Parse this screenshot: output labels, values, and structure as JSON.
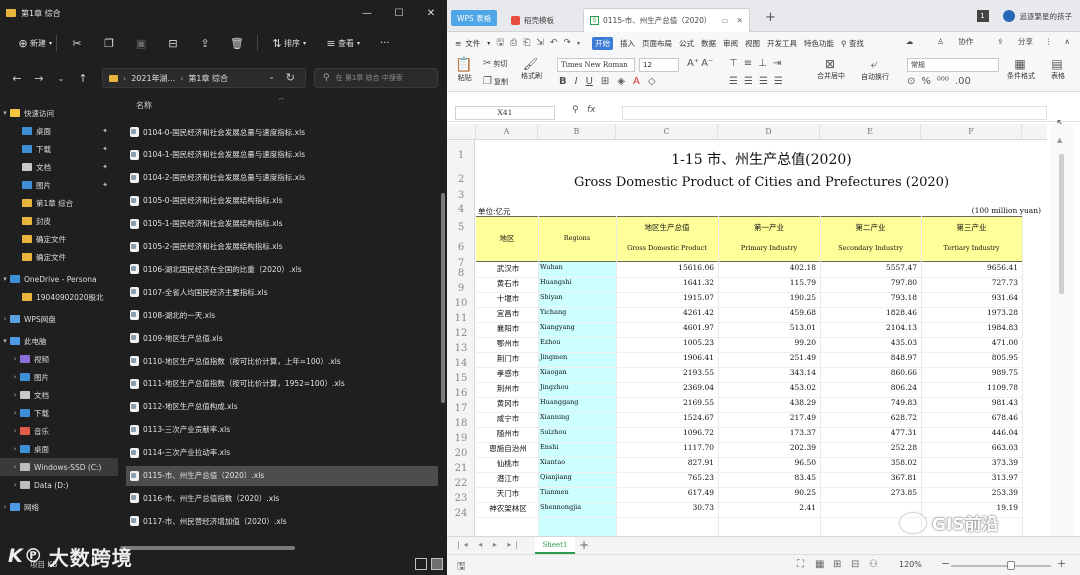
{
  "explorer": {
    "title": "第1章 综合",
    "controls": [
      "—",
      "☐",
      "✕"
    ],
    "commands": {
      "new": "新建",
      "sort": "排序",
      "view": "查看",
      "more": "···"
    },
    "address": {
      "segments": [
        "2021年湖...",
        "第1章 综合"
      ]
    },
    "search_placeholder": "在 第1章 综合 中搜索",
    "column_header": "名称",
    "nav": [
      {
        "label": "快速访问",
        "expander": "▾",
        "icon": "star-icon",
        "color": "#f4c542"
      },
      {
        "label": "桌面",
        "icon": "desktop-icon",
        "color": "#3f8fd8",
        "pinned": true
      },
      {
        "label": "下载",
        "icon": "download-icon",
        "color": "#3f8fd8",
        "pinned": true
      },
      {
        "label": "文档",
        "icon": "document-icon",
        "color": "#c9c9c9",
        "pinned": true
      },
      {
        "label": "图片",
        "icon": "picture-icon",
        "color": "#3f8fd8",
        "pinned": true
      },
      {
        "label": "第1章 综合",
        "icon": "folder-icon",
        "color": "#e8b53c"
      },
      {
        "label": "封皮",
        "icon": "folder-icon",
        "color": "#e8b53c"
      },
      {
        "label": "确定文件",
        "icon": "folder-icon",
        "color": "#e8b53c"
      },
      {
        "label": "确定文件",
        "icon": "folder-icon",
        "color": "#e8b53c"
      },
      {
        "label": "OneDrive - Persona",
        "expander": "▾",
        "icon": "cloud-icon",
        "color": "#3f8fd8"
      },
      {
        "label": "19040902020股北",
        "icon": "folder-icon",
        "color": "#e8b53c"
      },
      {
        "label": "WPS网盘",
        "expander": "›",
        "icon": "cloud-drive-icon",
        "color": "#5aa0e0"
      },
      {
        "label": "此电脑",
        "expander": "▾",
        "icon": "computer-icon",
        "color": "#4f9be6"
      },
      {
        "label": "视频",
        "expander": "›",
        "icon": "video-icon",
        "color": "#8a6fd6"
      },
      {
        "label": "图片",
        "expander": "›",
        "icon": "picture-icon",
        "color": "#3f8fd8"
      },
      {
        "label": "文档",
        "expander": "›",
        "icon": "document-icon",
        "color": "#c9c9c9"
      },
      {
        "label": "下载",
        "expander": "›",
        "icon": "download-icon",
        "color": "#3f8fd8"
      },
      {
        "label": "音乐",
        "expander": "›",
        "icon": "music-icon",
        "color": "#e35c4a"
      },
      {
        "label": "桌面",
        "expander": "›",
        "icon": "desktop-icon",
        "color": "#3f8fd8"
      },
      {
        "label": "Windows-SSD (C:)",
        "expander": "›",
        "icon": "drive-icon",
        "color": "#bdbdbd",
        "selected": true
      },
      {
        "label": "Data (D:)",
        "expander": "›",
        "icon": "drive-icon",
        "color": "#bdbdbd"
      },
      {
        "label": "网络",
        "expander": "›",
        "icon": "network-icon",
        "color": "#4f9be6"
      }
    ],
    "files": [
      "0104-0-国民经济和社会发展总量与速度指标.xls",
      "0104-1-国民经济和社会发展总量与速度指标.xls",
      "0104-2-国民经济和社会发展总量与速度指标.xls",
      "0105-0-国民经济和社会发展结构指标.xls",
      "0105-1-国民经济和社会发展结构指标.xls",
      "0105-2-国民经济和社会发展结构指标.xls",
      "0106-湖北国民经济在全国的比重（2020）.xls",
      "0107-全省人均国民经济主要指标.xls",
      "0108-湖北的一天.xls",
      "0109-地区生产总值.xls",
      "0110-地区生产总值指数（按可比价计算，上年=100）.xls",
      "0111-地区生产总值指数（按可比价计算，1952=100）.xls",
      "0112-地区生产总值构成.xls",
      "0113-三次产业贡献率.xls",
      "0114-三次产业拉动率.xls",
      "0115-市、州生产总值（2020）.xls",
      "0116-市、州生产总值指数（2020）.xls",
      "0117-市、州民营经济增加值（2020）.xls"
    ],
    "selected_file_index": 15,
    "status": "项目  KB",
    "watermark": "大数跨境"
  },
  "wps": {
    "tabs": {
      "home": "WPS 表格",
      "template": "稻壳模板",
      "active": "0115-市、州生产总值（2020）"
    },
    "user_name": "追逐繁星的孩子",
    "menu": [
      "文件",
      "开始",
      "插入",
      "页面布局",
      "公式",
      "数据",
      "审阅",
      "视图",
      "开发工具",
      "特色功能",
      "查找"
    ],
    "menu_right": [
      "协作",
      "分享"
    ],
    "ribbon": {
      "paste": "粘贴",
      "cut": "剪切",
      "copy": "复制",
      "format_painter": "格式刷",
      "font_name": "Times New Roman",
      "font_size": "12",
      "merge": "合并居中",
      "wrap": "自动换行",
      "number_format": "常规",
      "cond_format": "条件格式",
      "table_style": "表格"
    },
    "name_box": "X41",
    "fx": "fx",
    "columns": [
      "A",
      "B",
      "C",
      "D",
      "E",
      "F"
    ],
    "rows": [
      "1",
      "2",
      "3",
      "4",
      "5",
      "6",
      "7",
      "8",
      "9",
      "10",
      "11",
      "12",
      "13",
      "14",
      "15",
      "16",
      "17",
      "18",
      "19",
      "20",
      "21",
      "22",
      "23",
      "24"
    ],
    "sheet": {
      "title_cn": "1-15  市、州生产总值(2020)",
      "title_en": "Gross Domestic Product of Cities and Prefectures (2020)",
      "unit_cn": "单位:亿元",
      "unit_en": "(100 million yuan)",
      "headers": {
        "region_cn": "地区",
        "region_en": "Regions",
        "gdp_cn": "地区生产总值",
        "gdp_en": "Gross Domestic Product",
        "primary_cn": "第一产业",
        "primary_en": "Primary Industry",
        "secondary_cn": "第二产业",
        "secondary_en": "Secondary Industry",
        "tertiary_cn": "第三产业",
        "tertiary_en": "Tertiary Industry"
      },
      "data": [
        [
          "武汉市",
          "Wuhan",
          "15616.06",
          "402.18",
          "5557.47",
          "9656.41"
        ],
        [
          "黄石市",
          "Huangshi",
          "1641.32",
          "115.79",
          "797.80",
          "727.73"
        ],
        [
          "十堰市",
          "Shiyan",
          "1915.07",
          "190.25",
          "793.18",
          "931.64"
        ],
        [
          "宜昌市",
          "Yichang",
          "4261.42",
          "459.68",
          "1828.46",
          "1973.28"
        ],
        [
          "襄阳市",
          "Xiangyang",
          "4601.97",
          "513.01",
          "2104.13",
          "1984.83"
        ],
        [
          "鄂州市",
          "Ezhou",
          "1005.23",
          "99.20",
          "435.03",
          "471.00"
        ],
        [
          "荆门市",
          "Jingmen",
          "1906.41",
          "251.49",
          "848.97",
          "805.95"
        ],
        [
          "孝感市",
          "Xiaogan",
          "2193.55",
          "343.14",
          "860.66",
          "989.75"
        ],
        [
          "荆州市",
          "Jingzhou",
          "2369.04",
          "453.02",
          "806.24",
          "1109.78"
        ],
        [
          "黄冈市",
          "Huanggang",
          "2169.55",
          "438.29",
          "749.83",
          "981.43"
        ],
        [
          "咸宁市",
          "Xianning",
          "1524.67",
          "217.49",
          "628.72",
          "678.46"
        ],
        [
          "随州市",
          "Suizhou",
          "1096.72",
          "173.37",
          "477.31",
          "446.04"
        ],
        [
          "恩施自治州",
          "Enshi",
          "1117.70",
          "202.39",
          "252.28",
          "663.03"
        ],
        [
          "仙桃市",
          "Xiantao",
          "827.91",
          "96.50",
          "358.02",
          "373.39"
        ],
        [
          "潜江市",
          "Qianjiang",
          "765.23",
          "83.45",
          "367.81",
          "313.97"
        ],
        [
          "天门市",
          "Tianmen",
          "617.49",
          "90.25",
          "273.85",
          "253.39"
        ],
        [
          "神农架林区",
          "Shennongjia",
          "30.73",
          "2.41",
          "",
          "19.19"
        ]
      ]
    },
    "sheet_tab": "Sheet1",
    "zoom": "120%",
    "accent": "#2f9a4c",
    "header_fill": "#ffff99",
    "region_fill": "#ccffff"
  },
  "watermark_right": "GIS前沿"
}
